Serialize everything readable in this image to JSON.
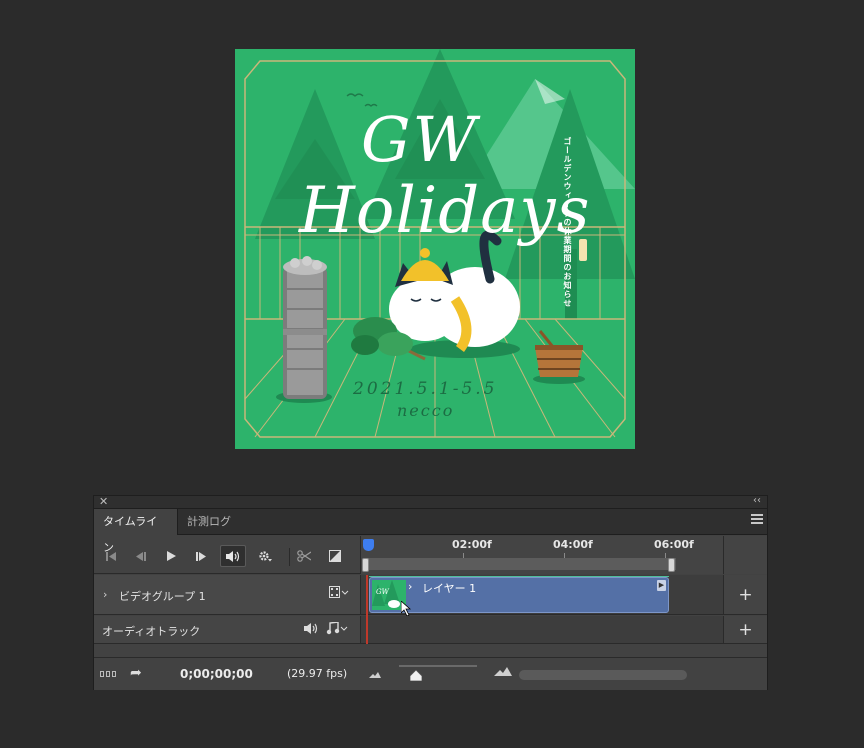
{
  "artwork": {
    "title": "GW",
    "subtitle": "Holidays",
    "vertical_note": "ゴールデンウィークの休業期間のお知らせ",
    "dates": "2021.5.1-5.5",
    "brand": "necco"
  },
  "panel": {
    "tabs": [
      {
        "label": "タイムライン",
        "active": true
      },
      {
        "label": "計測ログ",
        "active": false
      }
    ]
  },
  "ruler": {
    "labels": [
      "02:00f",
      "04:00f",
      "06:00f"
    ]
  },
  "tracks": {
    "video_group": "ビデオグループ 1",
    "audio_track": "オーディオトラック",
    "clip_label": "レイヤー 1"
  },
  "footer": {
    "timecode": "0;00;00;00",
    "fps": "(29.97 fps)"
  },
  "colors": {
    "canvas_green": "#2db36b",
    "clip_blue": "#5470a6",
    "playhead": "#3e7ef0"
  }
}
